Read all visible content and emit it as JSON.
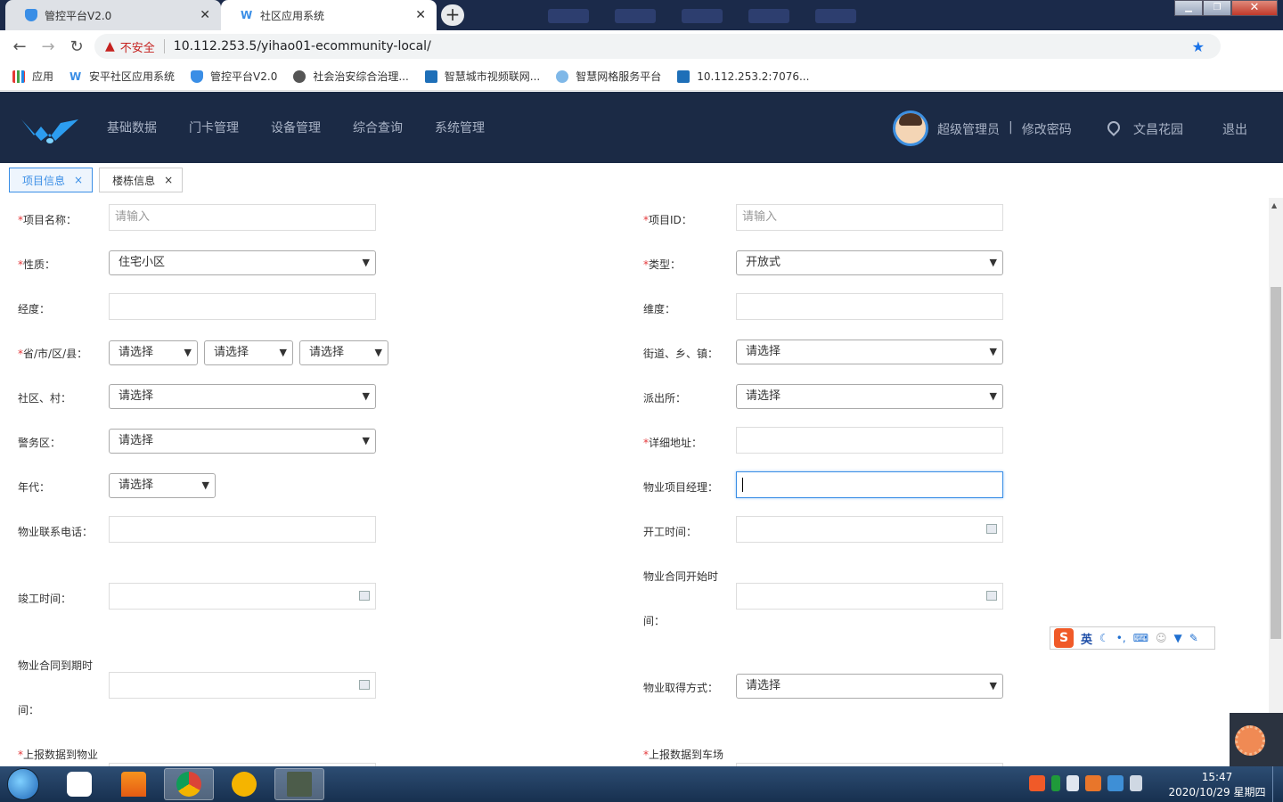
{
  "browser": {
    "tabs": [
      {
        "title": "管控平台V2.0",
        "active": false
      },
      {
        "title": "社区应用系统",
        "active": true
      }
    ],
    "insecure_label": "不安全",
    "url": "10.112.253.5/yihao01-ecommunity-local/",
    "bookmarks": [
      {
        "label": "应用",
        "icon": "apps-grid-icon"
      },
      {
        "label": "安平社区应用系统",
        "icon": "app-logo-icon"
      },
      {
        "label": "管控平台V2.0",
        "icon": "shield-icon"
      },
      {
        "label": "社会治安综合治理...",
        "icon": "globe-icon"
      },
      {
        "label": "智慧城市视频联网...",
        "icon": "e-browser-icon"
      },
      {
        "label": "智慧网格服务平台",
        "icon": "network-icon"
      },
      {
        "label": "10.112.253.2:7076...",
        "icon": "e-browser-icon"
      }
    ]
  },
  "header": {
    "nav": [
      "基础数据",
      "门卡管理",
      "设备管理",
      "综合查询",
      "系统管理"
    ],
    "user": "超级管理员",
    "separator": "|",
    "change_password": "修改密码",
    "location": "文昌花园",
    "logout": "退出"
  },
  "page_tabs": [
    {
      "label": "项目信息",
      "close": "×",
      "active": true
    },
    {
      "label": "楼栋信息",
      "close": "×",
      "active": false
    }
  ],
  "form": {
    "required_mark": "*",
    "project_name": {
      "label": "项目名称：",
      "placeholder": "请输入"
    },
    "project_id": {
      "label": "项目ID：",
      "placeholder": "请输入"
    },
    "nature": {
      "label": "性质：",
      "value": "住宅小区"
    },
    "type": {
      "label": "类型：",
      "value": "开放式"
    },
    "longitude": {
      "label": "经度："
    },
    "latitude": {
      "label": "维度："
    },
    "region": {
      "label": "省/市/区/县：",
      "province": "请选择",
      "city": "请选择",
      "county": "请选择"
    },
    "street": {
      "label": "街道、乡、镇：",
      "value": "请选择"
    },
    "community": {
      "label": "社区、村：",
      "value": "请选择"
    },
    "police_station": {
      "label": "派出所：",
      "value": "请选择"
    },
    "police_area": {
      "label": "警务区：",
      "value": "请选择"
    },
    "address": {
      "label": "详细地址："
    },
    "era": {
      "label": "年代：",
      "value": "请选择"
    },
    "property_manager": {
      "label": "物业项目经理："
    },
    "property_phone": {
      "label": "物业联系电话："
    },
    "start_time": {
      "label": "开工时间："
    },
    "completion_time": {
      "label": "竣工时间："
    },
    "contract_start": {
      "label_line1": "物业合同开始时",
      "label_line2": "间："
    },
    "contract_end": {
      "label_line1": "物业合同到期时",
      "label_line2": "间："
    },
    "acquisition": {
      "label": "物业取得方式：",
      "value": "请选择"
    },
    "report_property": {
      "label": "上报数据到物业"
    },
    "report_parking": {
      "label": "上报数据到车场"
    }
  },
  "ime": {
    "logo": "S",
    "mode": "英"
  },
  "taskbar": {
    "apps": [
      "baidu-netdisk-icon",
      "vlc-icon",
      "chrome-icon",
      "shield-browser-icon",
      "terminal-icon"
    ],
    "time": "15:47",
    "date": "2020/10/29 星期四"
  }
}
